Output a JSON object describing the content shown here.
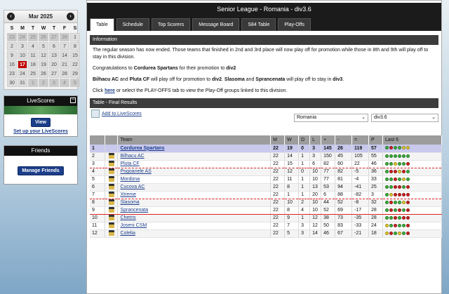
{
  "calendar": {
    "title": "Mar 2025",
    "dow": [
      "S",
      "M",
      "T",
      "W",
      "T",
      "F",
      "S"
    ],
    "weeks": [
      [
        {
          "d": "23",
          "o": true
        },
        {
          "d": "24",
          "o": true
        },
        {
          "d": "25",
          "o": true
        },
        {
          "d": "26",
          "o": true
        },
        {
          "d": "27",
          "o": true
        },
        {
          "d": "28",
          "o": true
        },
        {
          "d": "1",
          "o": false
        }
      ],
      [
        {
          "d": "2",
          "o": false
        },
        {
          "d": "3",
          "o": false
        },
        {
          "d": "4",
          "o": false
        },
        {
          "d": "5",
          "o": false
        },
        {
          "d": "6",
          "o": false
        },
        {
          "d": "7",
          "o": false
        },
        {
          "d": "8",
          "o": false
        }
      ],
      [
        {
          "d": "9",
          "o": false
        },
        {
          "d": "10",
          "o": false
        },
        {
          "d": "11",
          "o": false
        },
        {
          "d": "12",
          "o": false
        },
        {
          "d": "13",
          "o": false
        },
        {
          "d": "14",
          "o": false
        },
        {
          "d": "15",
          "o": false
        }
      ],
      [
        {
          "d": "16",
          "o": false
        },
        {
          "d": "17",
          "o": false,
          "today": true
        },
        {
          "d": "18",
          "o": false
        },
        {
          "d": "19",
          "o": false
        },
        {
          "d": "20",
          "o": false
        },
        {
          "d": "21",
          "o": false
        },
        {
          "d": "22",
          "o": false
        }
      ],
      [
        {
          "d": "23",
          "o": false
        },
        {
          "d": "24",
          "o": false
        },
        {
          "d": "25",
          "o": false
        },
        {
          "d": "26",
          "o": false
        },
        {
          "d": "27",
          "o": false
        },
        {
          "d": "28",
          "o": false
        },
        {
          "d": "29",
          "o": false
        }
      ],
      [
        {
          "d": "30",
          "o": false
        },
        {
          "d": "31",
          "o": false
        },
        {
          "d": "1",
          "o": true
        },
        {
          "d": "2",
          "o": true
        },
        {
          "d": "3",
          "o": true
        },
        {
          "d": "4",
          "o": true
        },
        {
          "d": "5",
          "o": true
        }
      ]
    ]
  },
  "livescores": {
    "title": "LiveScores",
    "min": "−",
    "view_label": "View",
    "setup_label": "Set up your LiveScores"
  },
  "friends": {
    "title": "Friends",
    "manage_label": "Manage Friends"
  },
  "main": {
    "league_title": "Senior League - Romania - div3.6",
    "tabs": [
      "Table",
      "Schedule",
      "Top Scorers",
      "Message Board",
      "S84 Table",
      "Play-Offs"
    ],
    "info_head": "Information",
    "info_p1": "The regular season has now ended. Those teams that finished in 2nd and 3rd place will now play off for promotion while those in 8th and 9th will play off to stay in this division.",
    "congrats_pre": "Congratulations to ",
    "congrats_team": "Cordurea Spartans",
    "congrats_mid": " for their promotion to ",
    "congrats_div": "div2",
    "playoff_t1": "Bilhacu AC",
    "playoff_and": " and ",
    "playoff_t2": "Pluta CF",
    "playoff_mid1": " will play off for promotion to ",
    "playoff_div1": "div2",
    "playoff_dot": ". ",
    "playoff_t3": "Slasoma",
    "playoff_t4": "Sprancenata",
    "playoff_mid2": " will play off to stay in ",
    "playoff_div2": "div3",
    "playoff_end": ".",
    "click_pre": "Click ",
    "click_link": "here",
    "click_post": " or select the PLAY-OFFS tab to view the Play-Off groups linked to this division.",
    "table_head": "Table - Final Results",
    "add_ls": "Add to LiveScores",
    "country": "Romania",
    "division": "div3.6"
  },
  "table": {
    "headers": [
      "",
      "",
      "Team",
      "M",
      "W",
      "D",
      "L",
      "+",
      "-",
      "=",
      "P",
      "Last 6"
    ],
    "rows": [
      {
        "pos": "1",
        "team": "Cordurea Spartans",
        "m": "22",
        "w": "19",
        "d": "0",
        "l": "3",
        "gf": "145",
        "ga": "26",
        "gd": "119",
        "p": "57",
        "last": [
          "W",
          "L",
          "W",
          "W",
          "D",
          "D"
        ]
      },
      {
        "pos": "2",
        "team": "Bilhacu AC",
        "m": "22",
        "w": "14",
        "d": "1",
        "l": "3",
        "gf": "150",
        "ga": "45",
        "gd": "105",
        "p": "55",
        "last": [
          "W",
          "W",
          "W",
          "W",
          "W",
          "W"
        ]
      },
      {
        "pos": "3",
        "team": "Pluta CF",
        "m": "22",
        "w": "15",
        "d": "1",
        "l": "6",
        "gf": "82",
        "ga": "60",
        "gd": "22",
        "p": "46",
        "last": [
          "W",
          "W",
          "D",
          "W",
          "W",
          "L"
        ]
      },
      {
        "pos": "4",
        "team": "Pogoanele AS",
        "m": "22",
        "w": "12",
        "d": "0",
        "l": "10",
        "gf": "77",
        "ga": "82",
        "gd": "-5",
        "p": "36",
        "last": [
          "W",
          "L",
          "L",
          "D",
          "L",
          "W"
        ]
      },
      {
        "pos": "5",
        "team": "Mordona",
        "m": "22",
        "w": "11",
        "d": "1",
        "l": "10",
        "gf": "77",
        "ga": "81",
        "gd": "-4",
        "p": "33",
        "last": [
          "W",
          "W",
          "L",
          "W",
          "D",
          "W"
        ]
      },
      {
        "pos": "6",
        "team": "Cucova AC",
        "m": "22",
        "w": "8",
        "d": "1",
        "l": "13",
        "gf": "53",
        "ga": "94",
        "gd": "-41",
        "p": "25",
        "last": [
          "W",
          "W",
          "L",
          "L",
          "W",
          "L"
        ]
      },
      {
        "pos": "7",
        "team": "Xtreme",
        "m": "22",
        "w": "1",
        "d": "1",
        "l": "20",
        "gf": "6",
        "ga": "88",
        "gd": "-82",
        "p": "3",
        "last": [
          "W",
          "D",
          "L",
          "L",
          "L",
          "L"
        ]
      },
      {
        "pos": "8",
        "team": "Slasoma",
        "m": "22",
        "w": "10",
        "d": "2",
        "l": "10",
        "gf": "44",
        "ga": "52",
        "gd": "-8",
        "p": "32",
        "last": [
          "W",
          "L",
          "W",
          "W",
          "D",
          "L"
        ]
      },
      {
        "pos": "9",
        "team": "Sprancenata",
        "m": "22",
        "w": "8",
        "d": "4",
        "l": "10",
        "gf": "52",
        "ga": "69",
        "gd": "-17",
        "p": "28",
        "last": [
          "W",
          "L",
          "W",
          "L",
          "W",
          "L"
        ]
      },
      {
        "pos": "10",
        "team": "Chetris",
        "m": "22",
        "w": "9",
        "d": "1",
        "l": "12",
        "gf": "38",
        "ga": "73",
        "gd": "-35",
        "p": "28",
        "last": [
          "W",
          "W",
          "L",
          "W",
          "L",
          "L"
        ]
      },
      {
        "pos": "11",
        "team": "Joseni CSM",
        "m": "22",
        "w": "7",
        "d": "3",
        "l": "12",
        "gf": "50",
        "ga": "83",
        "gd": "-33",
        "p": "24",
        "last": [
          "D",
          "W",
          "L",
          "W",
          "W",
          "L"
        ]
      },
      {
        "pos": "12",
        "team": "Colelia",
        "m": "22",
        "w": "5",
        "d": "3",
        "l": "14",
        "gf": "46",
        "ga": "67",
        "gd": "-21",
        "p": "18",
        "last": [
          "D",
          "L",
          "W",
          "D",
          "W",
          "L"
        ]
      }
    ]
  }
}
